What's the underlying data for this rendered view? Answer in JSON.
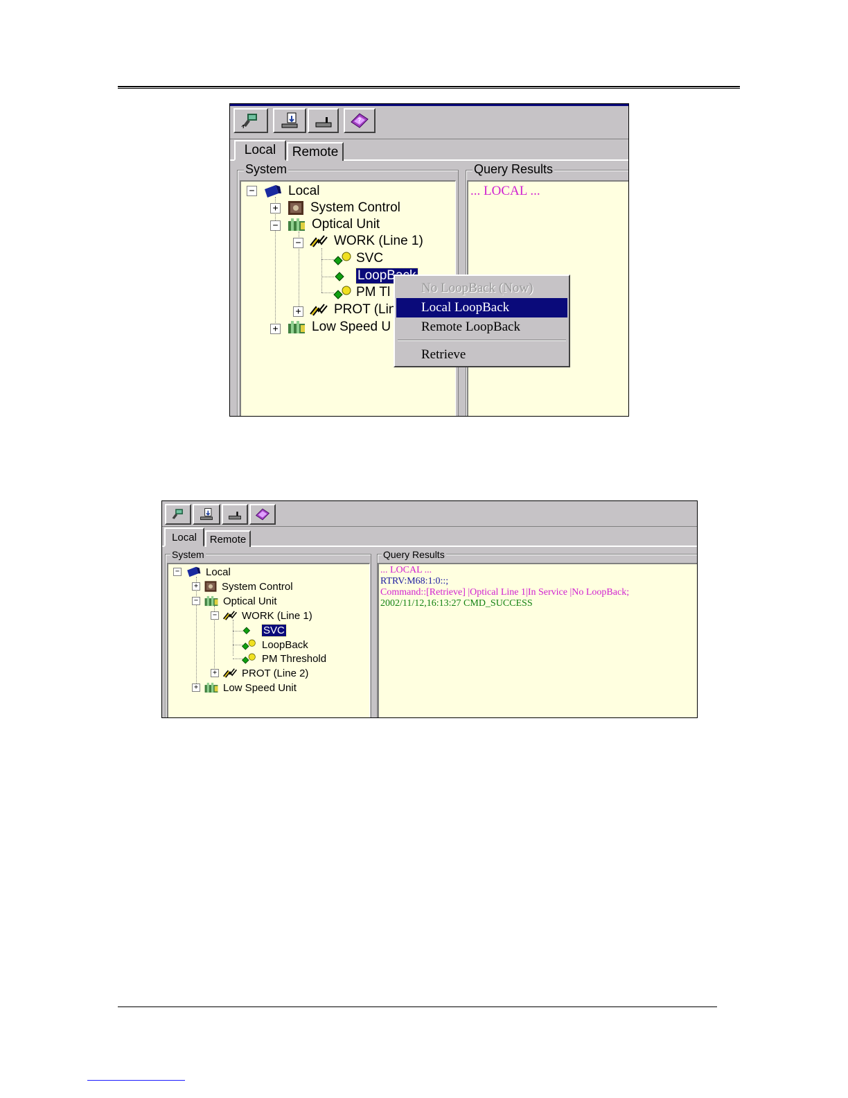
{
  "colors": {
    "window_bg": "#c6c3c6",
    "pane_bg": "#ffffe0",
    "selection": "#0a0a7a",
    "magenta_text": "#d020d0",
    "blue_text": "#1a1aa0",
    "green_text": "#108010"
  },
  "toolbar": {
    "buttons": [
      "connect-icon",
      "download-icon",
      "disconnect-icon",
      "help-book-icon"
    ]
  },
  "tabs": [
    "Local",
    "Remote"
  ],
  "system_label": "System",
  "query_label": "Query Results",
  "tree": {
    "root": "Local",
    "system_control": "System Control",
    "optical_unit": "Optical Unit",
    "work": "WORK (Line 1)",
    "svc": "SVC",
    "loopback": "LoopBack",
    "pm": "PM Threshold",
    "prot": "PROT (Line 2)",
    "low_speed": "Low Speed Unit"
  },
  "shot1": {
    "tree_visible": {
      "loopback": "LoopBack",
      "pm": "PM Tl",
      "prot": "PROT (Lin",
      "low_speed": "Low Speed U"
    },
    "query_result": "... LOCAL ...",
    "menu": {
      "no_loopback": "No LoopBack (Now)",
      "local_loopback": "Local LoopBack",
      "remote_loopback": "Remote LoopBack",
      "retrieve": "Retrieve"
    }
  },
  "shot2": {
    "results": [
      "... LOCAL ...",
      "RTRV:M68:1:0::;",
      "Command::[Retrieve] |Optical Line 1|In Service |No LoopBack;",
      "2002/11/12,16:13:27 CMD_SUCCESS"
    ]
  }
}
